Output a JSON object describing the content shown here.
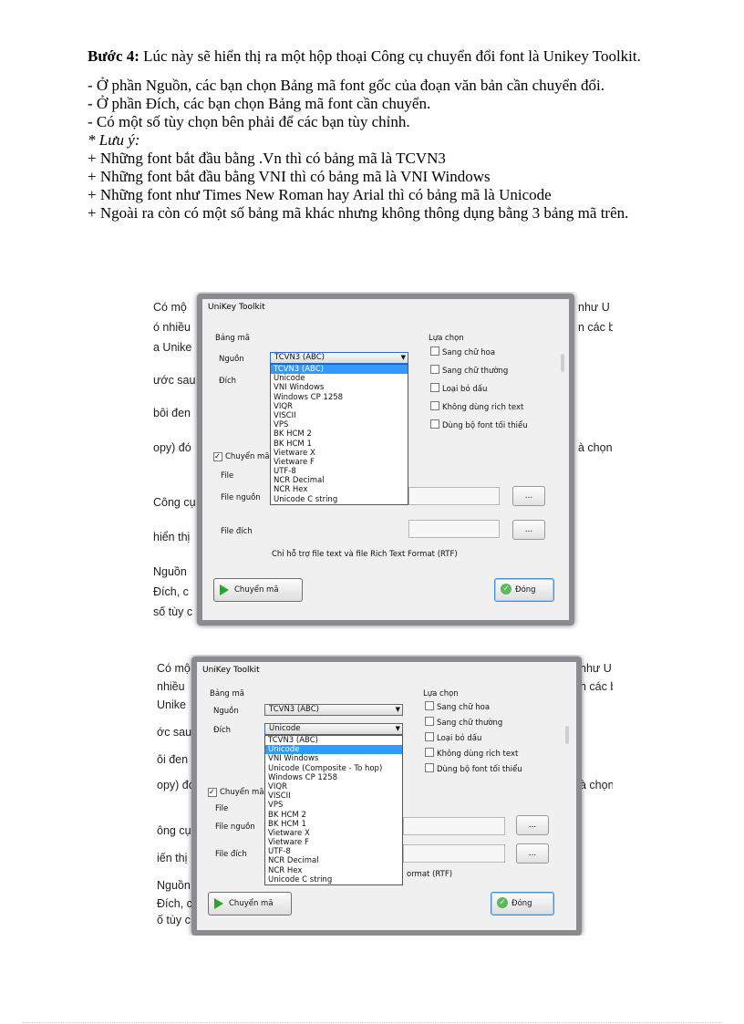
{
  "doc": {
    "step_label": "Bước 4:",
    "step_text": " Lúc này sẽ hiển thị ra một hộp thoại Công cụ chuyển đổi font là Unikey Toolkit.",
    "lines": [
      "- Ở phần Nguồn, các bạn chọn Bảng mã font gốc của đoạn văn bản cần chuyển đổi.",
      "- Ở phần Đích, các bạn chọn Bảng mã font cần chuyển.",
      "- Có một số tùy chọn bên phải để các bạn tùy chỉnh."
    ],
    "note": "* Lưu ý:",
    "notes": [
      "+ Những font bắt đầu bằng .Vn thì có bảng mã là TCVN3",
      "+ Những font bắt đầu bằng VNI thì có bảng mã là VNI Windows",
      "+ Những font như Times New Roman hay Arial thì có bảng mã là Unicode",
      "+ Ngoài ra còn có một số bảng mã khác nhưng không thông dụng bằng 3 bảng mã trên."
    ]
  },
  "bg_text": {
    "left1": [
      "Có mộ",
      "ó nhiều",
      "a Unike",
      "ước sau",
      "bôi đen",
      "opy) đó",
      "",
      "Công cụ",
      "hiển thị",
      "Nguồn",
      "Đích, c",
      "số tùy c"
    ],
    "right1": [
      "như U",
      "n các bạ",
      "à chọn"
    ],
    "left2": [
      "Có mộ",
      "nhiều",
      "Unike",
      "ớc sau",
      "ôi đen",
      "opy) đó",
      "ông cụ",
      "iến thị",
      "Nguồn",
      "Đích, c",
      "ố tùy c"
    ],
    "right2": [
      "như U",
      "n các bạ",
      "à chọn"
    ]
  },
  "dialog1": {
    "title": "UniKey Toolkit",
    "group_label": "Bảng mã",
    "source_label": "Nguồn",
    "target_label": "Đích",
    "source_value": "TCVN3 (ABC)",
    "options_label": "Lựa chọn",
    "options": [
      "Sang chữ hoa",
      "Sang chữ thường",
      "Loại bỏ dấu",
      "Không dùng rich text",
      "Dùng bộ font tối thiểu"
    ],
    "convert_check": "Chuyển mã",
    "file_label": "File",
    "file_source_label": "File nguồn",
    "file_target_label": "File đích",
    "browse": "...",
    "hint": "Chỉ hỗ trợ file text và file Rich Text Format (RTF)",
    "convert_button": "Chuyển mã",
    "close_button": "Đóng",
    "list": [
      "TCVN3 (ABC)",
      "Unicode",
      "VNI Windows",
      "Windows CP 1258",
      "VIQR",
      "VISCII",
      "VPS",
      "BK HCM 2",
      "BK HCM 1",
      "Vietware X",
      "Vietware F",
      "UTF-8",
      "NCR Decimal",
      "NCR Hex",
      "Unicode C string"
    ],
    "highlight": 0
  },
  "dialog2": {
    "title": "UniKey Toolkit",
    "group_label": "Bảng mã",
    "source_label": "Nguồn",
    "target_label": "Đích",
    "source_value": "TCVN3 (ABC)",
    "target_value": "Unicode",
    "options_label": "Lựa chọn",
    "options": [
      "Sang chữ hoa",
      "Sang chữ thường",
      "Loại bỏ dấu",
      "Không dùng rich text",
      "Dùng bộ font tối thiểu"
    ],
    "convert_check": "Chuyển mã",
    "file_label": "File",
    "file_source_label": "File nguồn",
    "file_target_label": "File đích",
    "browse": "...",
    "hint_tail": "ormat (RTF)",
    "convert_button": "Chuyển mã",
    "close_button": "Đóng",
    "list": [
      "TCVN3 (ABC)",
      "Unicode",
      "VNI Windows",
      "Unicode (Composite - To hop)",
      "Windows CP 1258",
      "VIQR",
      "VISCII",
      "VPS",
      "BK HCM 2",
      "BK HCM 1",
      "Vietware X",
      "Vietware F",
      "UTF-8",
      "NCR Decimal",
      "NCR Hex",
      "Unicode C string"
    ],
    "highlight": 1
  }
}
